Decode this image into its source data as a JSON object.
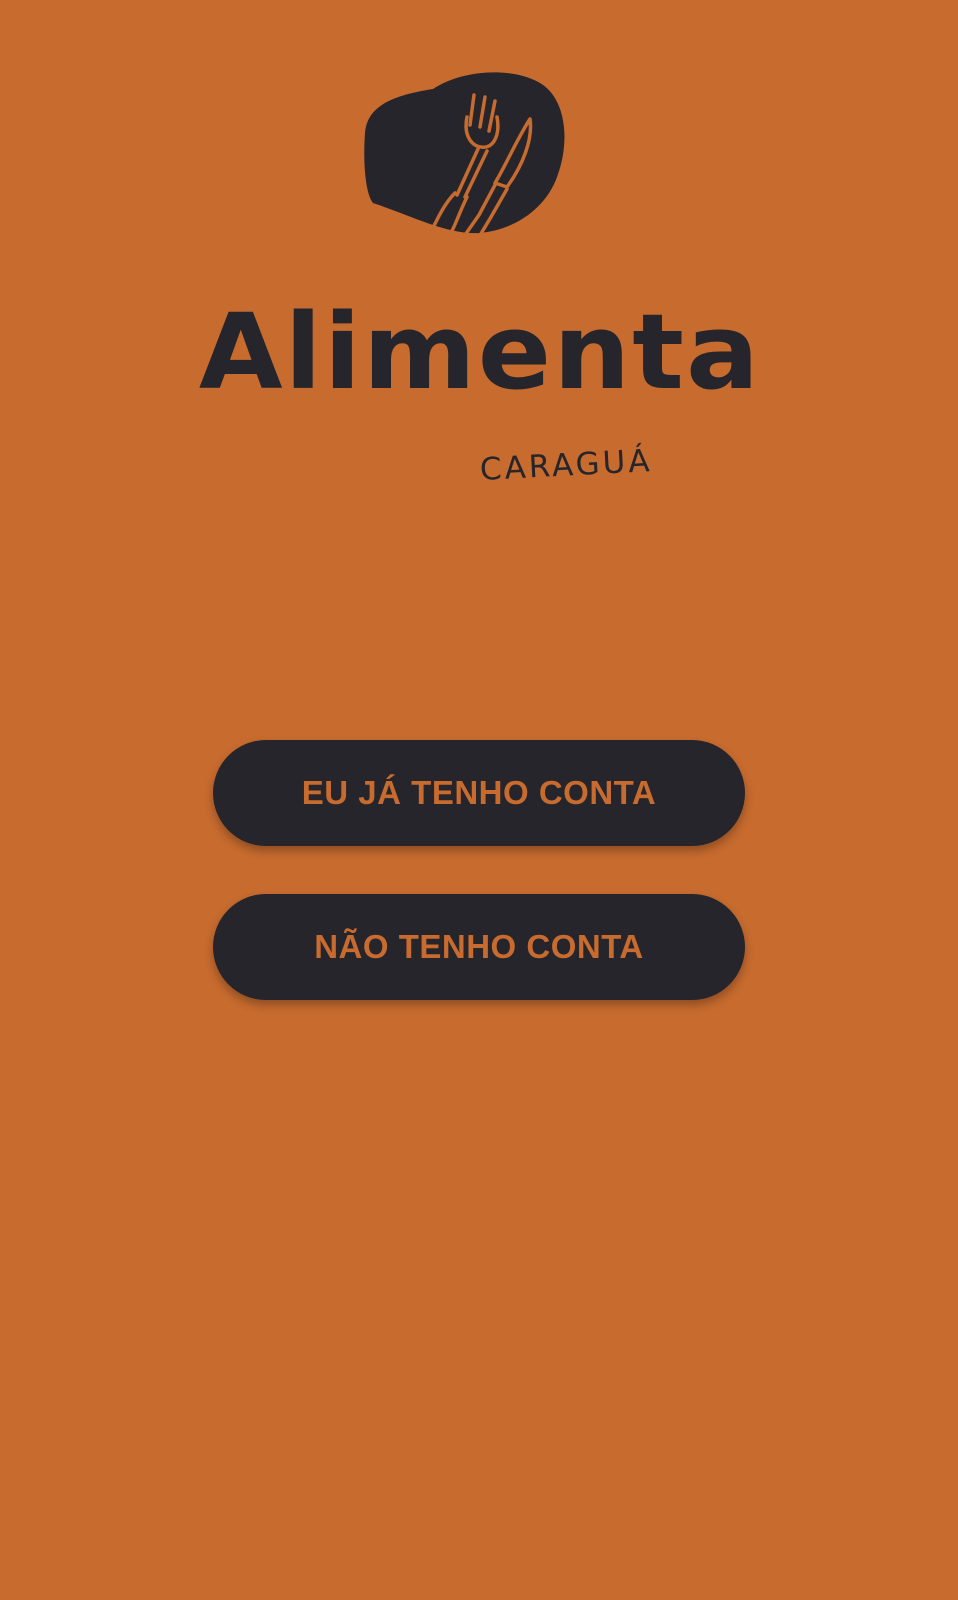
{
  "app": {
    "logo": {
      "wordmark": "Alimenta",
      "subtitle": "CARAGUÁ",
      "icon": "fork-knife-blob-icon"
    }
  },
  "actions": {
    "login_label": "EU JÁ TENHO CONTA",
    "signup_label": "NÃO TENHO CONTA"
  },
  "colors": {
    "background": "#c76b2f",
    "button_background": "#25252b",
    "button_text": "#c76b2f",
    "logo": "#25252b"
  }
}
